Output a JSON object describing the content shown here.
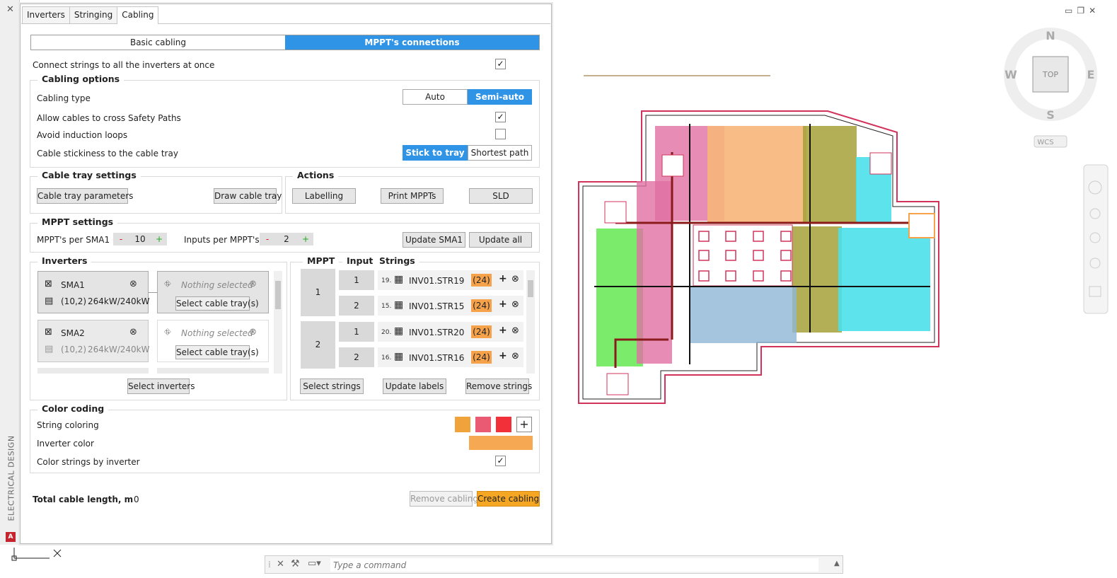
{
  "tabs": [
    "Inverters",
    "Stringing",
    "Cabling"
  ],
  "mode_tabs": [
    "Basic cabling",
    "MPPT's connections"
  ],
  "connect_all": {
    "label": "Connect strings to all the inverters at once",
    "checked": "✓"
  },
  "cabling_options": {
    "title": "Cabling options",
    "type_label": "Cabling type",
    "type_options": [
      "Auto",
      "Semi-auto"
    ],
    "cross_label": "Allow cables to cross Safety Paths",
    "cross_checked": "✓",
    "loops_label": "Avoid induction loops",
    "loops_checked": "",
    "stickiness_label": "Cable stickiness to the cable tray",
    "stickiness_options": [
      "Stick to tray",
      "Shortest path"
    ]
  },
  "tray_settings": {
    "title": "Cable tray settings",
    "params_button": "Cable tray parameters",
    "draw_button": "Draw cable tray"
  },
  "actions": {
    "title": "Actions",
    "labelling": "Labelling",
    "print_mppts": "Print MPPTs",
    "sld": "SLD"
  },
  "mppt_settings": {
    "title": "MPPT settings",
    "per_sma_label": "MPPT's per SMA1",
    "per_sma_value": "10",
    "inputs_label": "Inputs per MPPT's",
    "inputs_value": "2",
    "minus": "-",
    "plus": "+",
    "update_sma": "Update SMA1",
    "update_all": "Update all"
  },
  "inverters": {
    "title": "Inverters",
    "items": [
      {
        "name": "SMA1",
        "spec": "(10,2)",
        "power": "264kW/240kW",
        "tray_status": "Nothing selected",
        "tray_button": "Select cable tray(s)"
      },
      {
        "name": "SMA2",
        "spec": "(10,2)",
        "power": "264kW/240kW",
        "tray_status": "Nothing selected",
        "tray_button": "Select cable tray(s)"
      }
    ],
    "select_button": "Select inverters"
  },
  "strings": {
    "headers": [
      "MPPT",
      "Input",
      "Strings"
    ],
    "mppts": [
      "1",
      "2"
    ],
    "rows": [
      {
        "input": "1",
        "idx": "19.",
        "name": "INV01.STR19",
        "count": "(24)"
      },
      {
        "input": "2",
        "idx": "15.",
        "name": "INV01.STR15",
        "count": "(24)"
      },
      {
        "input": "1",
        "idx": "20.",
        "name": "INV01.STR20",
        "count": "(24)"
      },
      {
        "input": "2",
        "idx": "16.",
        "name": "INV01.STR16",
        "count": "(24)"
      }
    ],
    "select_button": "Select strings",
    "update_button": "Update labels",
    "remove_button": "Remove strings"
  },
  "color_coding": {
    "title": "Color coding",
    "string_label": "String coloring",
    "swatches": [
      "#f0a33a",
      "#ea5a72",
      "#f1303a"
    ],
    "add": "+",
    "inverter_label": "Inverter color",
    "inverter_color": "#f7a852",
    "by_inverter_label": "Color strings by inverter",
    "by_inverter_checked": "✓"
  },
  "footer": {
    "total_label": "Total cable length, m",
    "total_value": "0",
    "remove_button": "Remove cabling",
    "create_button": "Create cabling"
  },
  "sidebar": {
    "label": "ELECTRICAL DESIGN",
    "close": "✕",
    "logo": "A"
  },
  "viewcube": {
    "n": "N",
    "s": "S",
    "e": "E",
    "w": "W",
    "top": "TOP",
    "wcs": "WCS"
  },
  "command_line": {
    "placeholder": "Type a command"
  },
  "window_controls": [
    "▭",
    "❐",
    "✕"
  ]
}
